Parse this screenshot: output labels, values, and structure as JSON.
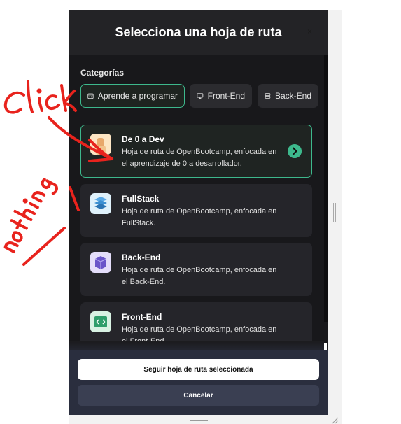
{
  "modal": {
    "title": "Selecciona una hoja de ruta",
    "close_label": "×"
  },
  "categories": {
    "label": "Categorías",
    "chips": [
      {
        "label": "Aprende a programar",
        "icon": "calendar-code-icon",
        "active": true
      },
      {
        "label": "Front-End",
        "icon": "monitor-icon",
        "active": false
      },
      {
        "label": "Back-End",
        "icon": "server-icon",
        "active": false
      }
    ]
  },
  "roadmaps": [
    {
      "title": "De 0 a Dev",
      "desc_line1": "Hoja de ruta de OpenBootcamp, enfocada en",
      "desc_line2": "el aprendizaje de 0 a desarrollador.",
      "icon": "person-thumbnail-icon",
      "selected": true
    },
    {
      "title": "FullStack",
      "desc_line1": "Hoja de ruta de OpenBootcamp, enfocada en",
      "desc_line2": "FullStack.",
      "icon": "layers-stack-icon",
      "selected": false
    },
    {
      "title": "Back-End",
      "desc_line1": "Hoja de ruta de OpenBootcamp, enfocada en",
      "desc_line2": "el Back-End.",
      "icon": "cube-stack-icon",
      "selected": false
    },
    {
      "title": "Front-End",
      "desc_line1": "Hoja de ruta de OpenBootcamp, enfocada en",
      "desc_line2": "el Front-End.",
      "icon": "code-window-icon",
      "selected": false
    }
  ],
  "footer": {
    "primary_label": "Seguir hoja de ruta seleccionada",
    "cancel_label": "Cancelar"
  },
  "annotations": {
    "word1": "Click",
    "word2": "nothing",
    "ink_color": "#e8231d"
  },
  "colors": {
    "accent": "#3db88c",
    "modal_bg": "#18181b",
    "card_bg": "#25252a",
    "footer_bg": "#2a2e3e"
  }
}
